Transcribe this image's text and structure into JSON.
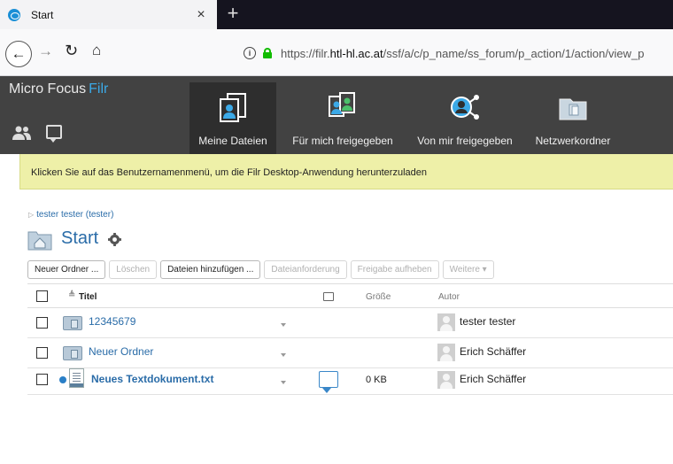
{
  "browser": {
    "tab_title": "Start",
    "tab_close": "×",
    "new_tab": "+",
    "url_prefix": "https://filr.",
    "url_domain": "htl-hl.ac.at",
    "url_path": "/ssf/a/c/p_name/ss_forum/p_action/1/action/view_p"
  },
  "app": {
    "brand_name": "Micro Focus",
    "brand_product": "Filr",
    "accent_color": "#3ba9e7",
    "nav_tabs": [
      {
        "label": "Meine Dateien",
        "icon": "my-files-icon",
        "active": true
      },
      {
        "label": "Für mich freigegeben",
        "icon": "shared-with-me-icon",
        "active": false
      },
      {
        "label": "Von mir freigegeben",
        "icon": "shared-by-me-icon",
        "active": false
      },
      {
        "label": "Netzwerkordner",
        "icon": "network-folder-icon",
        "active": false
      }
    ]
  },
  "banner": {
    "text": "Klicken Sie auf das Benutzernamenmenü, um die Filr Desktop-Anwendung herunterzuladen"
  },
  "breadcrumb": {
    "text": "tester tester (tester)"
  },
  "page": {
    "title": "Start"
  },
  "toolbar": {
    "buttons": [
      {
        "label": "Neuer Ordner ...",
        "enabled": true
      },
      {
        "label": "Löschen",
        "enabled": false
      },
      {
        "label": "Dateien hinzufügen ...",
        "enabled": true
      },
      {
        "label": "Dateianforderung",
        "enabled": false
      },
      {
        "label": "Freigabe aufheben",
        "enabled": false
      },
      {
        "label": "Weitere ▾",
        "enabled": false
      }
    ]
  },
  "table": {
    "headers": {
      "title": "Titel",
      "size": "Größe",
      "author": "Autor"
    },
    "rows": [
      {
        "name": "12345679",
        "type": "folder",
        "size": "",
        "author": "tester tester"
      },
      {
        "name": "Neuer Ordner",
        "type": "folder",
        "size": "",
        "author": "Erich Schäffer"
      },
      {
        "name": "Neues Textdokument.txt",
        "type": "file",
        "size": "0 KB",
        "author": "Erich Schäffer"
      }
    ]
  }
}
